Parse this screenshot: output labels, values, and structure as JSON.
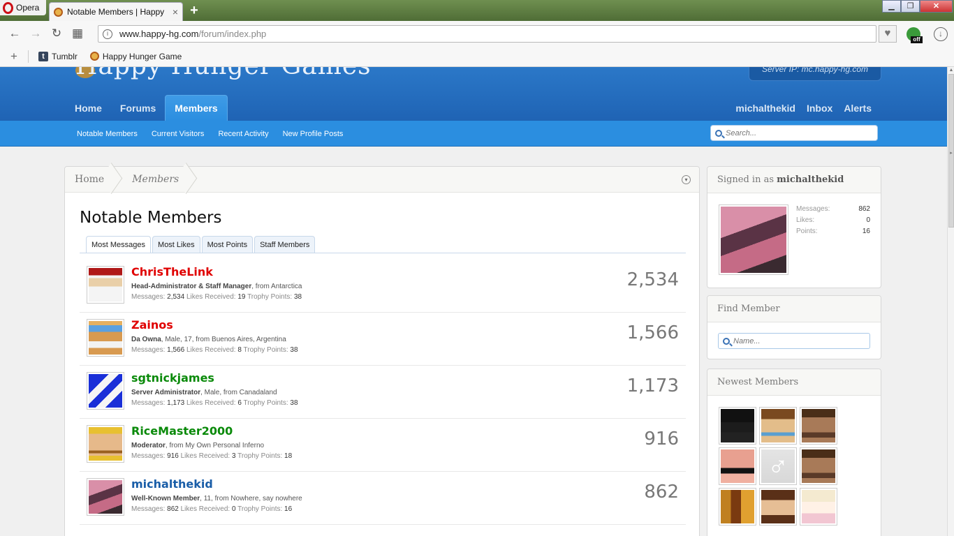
{
  "browser": {
    "menu_label": "Opera",
    "tab_title": "Notable Members | Happy",
    "address_host": "www.happy-hg.com",
    "address_path": "/forum/index.php",
    "ext_badge": "off",
    "bookmarks": [
      {
        "label": "Tumblr"
      },
      {
        "label": "Happy Hunger Game"
      }
    ]
  },
  "header": {
    "logo_text": "Happy Hunger Games",
    "server_ip": "Server IP: mc.happy-hg.com",
    "nav": [
      "Home",
      "Forums",
      "Members"
    ],
    "active_nav": "Members",
    "user_nav": [
      "michalthekid",
      "Inbox",
      "Alerts"
    ],
    "sub_nav": [
      "Notable Members",
      "Current Visitors",
      "Recent Activity",
      "New Profile Posts"
    ],
    "search_placeholder": "Search..."
  },
  "breadcrumb": [
    "Home",
    "Members"
  ],
  "page_title": "Notable Members",
  "tabs": [
    "Most Messages",
    "Most Likes",
    "Most Points",
    "Staff Members"
  ],
  "active_tab": "Most Messages",
  "members": [
    {
      "name": "ChrisTheLink",
      "color": "#e00000",
      "title": "Head-Administrator & Staff Manager",
      "details": ", from Antarctica",
      "messages": "2,534",
      "likes": "19",
      "points": "38",
      "count": "2,534",
      "avatar": "santa"
    },
    {
      "name": "Zainos",
      "color": "#e00000",
      "title": "Da Owna",
      "details": ", Male, 17, from Buenos Aires, Argentina",
      "messages": "1,566",
      "likes": "8",
      "points": "38",
      "count": "1,566",
      "avatar": "blue-hair"
    },
    {
      "name": "sgtnickjames",
      "color": "#0a8a0a",
      "title": "Server Administrator",
      "details": ", Male, from Canadaland",
      "messages": "1,173",
      "likes": "6",
      "points": "38",
      "count": "1,173",
      "avatar": "blue-white"
    },
    {
      "name": "RiceMaster2000",
      "color": "#0a8a0a",
      "title": "Moderator",
      "details": ", from My Own Personal Inferno",
      "messages": "916",
      "likes": "3",
      "points": "18",
      "count": "916",
      "avatar": "mustache"
    },
    {
      "name": "michalthekid",
      "color": "#1a5ea8",
      "title": "Well-Known Member",
      "details": ", 11, from Nowhere, say nowhere",
      "messages": "862",
      "likes": "0",
      "points": "16",
      "count": "862",
      "avatar": "pony"
    }
  ],
  "labels": {
    "messages": "Messages:",
    "likes_received": "Likes Received:",
    "trophy_points": "Trophy Points:"
  },
  "sidebar": {
    "signed_in_prefix": "Signed in as",
    "username": "michalthekid",
    "stats": [
      {
        "label": "Messages:",
        "value": "862"
      },
      {
        "label": "Likes:",
        "value": "0"
      },
      {
        "label": "Points:",
        "value": "16"
      }
    ],
    "find_member_title": "Find Member",
    "find_member_placeholder": "Name...",
    "newest_title": "Newest Members",
    "newest_avatars": [
      "dark",
      "brown-hair",
      "steve",
      "notch",
      "male-symbol",
      "steve",
      "gold-stripe",
      "girl",
      "blonde"
    ]
  }
}
